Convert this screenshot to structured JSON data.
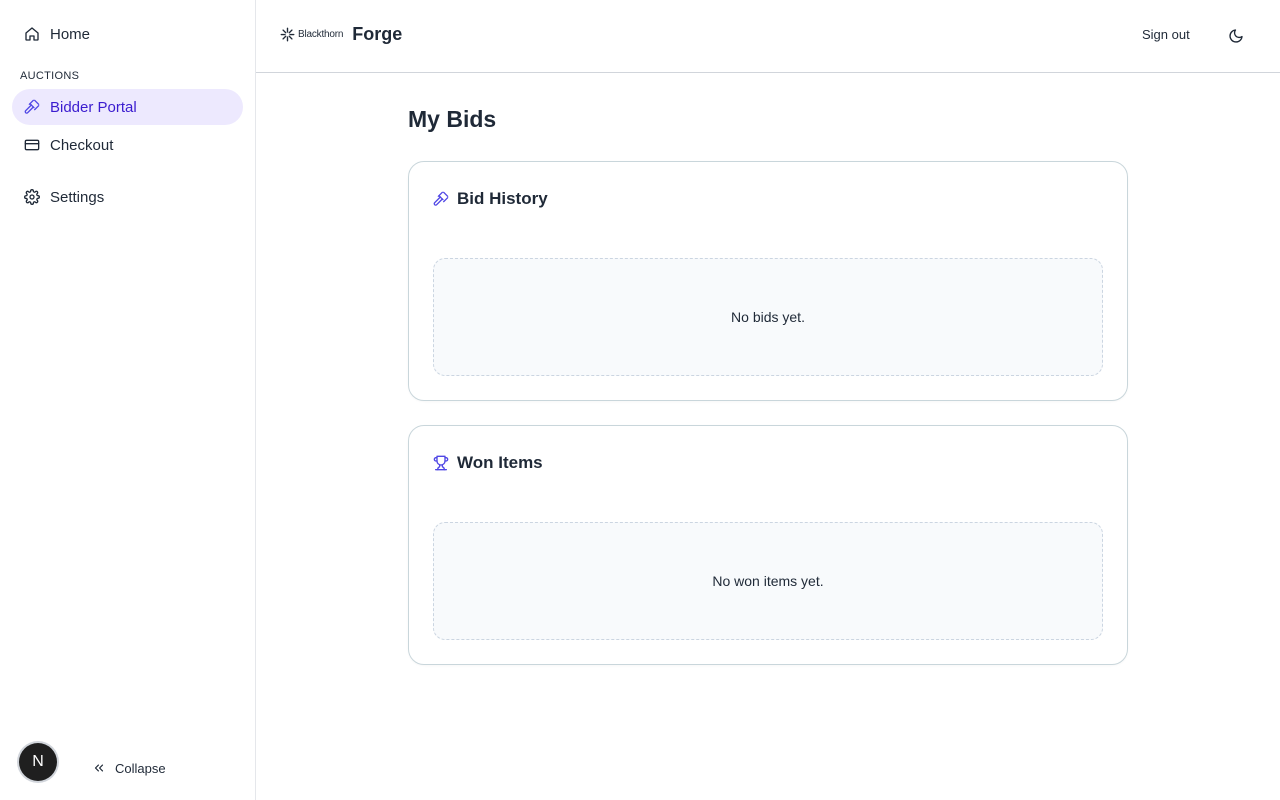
{
  "sidebar": {
    "home_label": "Home",
    "section_label": "AUCTIONS",
    "items": [
      {
        "label": "Bidder Portal"
      },
      {
        "label": "Checkout"
      }
    ],
    "settings_label": "Settings",
    "avatar_initial": "N",
    "collapse_label": "Collapse"
  },
  "header": {
    "brand_company": "Blackthorn",
    "brand_product": "Forge",
    "signout_label": "Sign out"
  },
  "main": {
    "title": "My Bids",
    "cards": [
      {
        "title": "Bid History",
        "empty_text": "No bids yet.",
        "icon": "gavel-icon"
      },
      {
        "title": "Won Items",
        "empty_text": "No won items yet.",
        "icon": "trophy-icon"
      }
    ]
  },
  "colors": {
    "accent": "#4f46e5",
    "active_bg": "#ede9fe",
    "border": "#c9d6db"
  }
}
